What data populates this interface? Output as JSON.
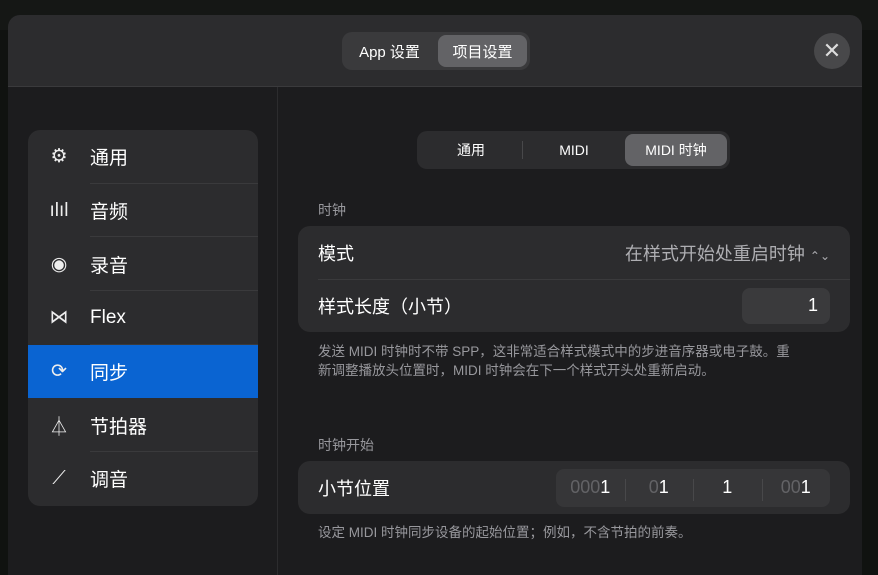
{
  "header": {
    "tabs": [
      {
        "label": "App 设置"
      },
      {
        "label": "项目设置"
      }
    ],
    "close": "✕"
  },
  "sidebar": {
    "items": [
      {
        "label": "通用",
        "icon": "gear-icon",
        "glyph": "⚙"
      },
      {
        "label": "音频",
        "icon": "waveform-icon",
        "glyph": "ılıl"
      },
      {
        "label": "录音",
        "icon": "record-icon",
        "glyph": "◉"
      },
      {
        "label": "Flex",
        "icon": "flex-icon",
        "glyph": "⋈"
      },
      {
        "label": "同步",
        "icon": "sync-icon",
        "glyph": "⟳"
      },
      {
        "label": "节拍器",
        "icon": "metronome-icon",
        "glyph": "⏃"
      },
      {
        "label": "调音",
        "icon": "tuning-icon",
        "glyph": "⟋"
      }
    ]
  },
  "tabs": [
    {
      "label": "通用"
    },
    {
      "label": "MIDI"
    },
    {
      "label": "MIDI 时钟"
    }
  ],
  "clock": {
    "title": "时钟",
    "mode_label": "模式",
    "mode_value": "在样式开始处重启时钟",
    "chevron": "⌃⌄",
    "length_label": "样式长度（小节）",
    "length_value": "1",
    "note": "发送 MIDI 时钟时不带 SPP，这非常适合样式模式中的步进音序器或电子鼓。重新调整播放头位置时，MIDI 时钟会在下一个样式开头处重新启动。"
  },
  "clock_start": {
    "title": "时钟开始",
    "position_label": "小节位置",
    "bar_dim": "000",
    "bar": "1",
    "beat_dim": "0",
    "beat": "1",
    "div": "1",
    "tick_dim": "00",
    "tick": "1",
    "note": "设定 MIDI 时钟同步设备的起始位置；例如，不含节拍的前奏。"
  }
}
